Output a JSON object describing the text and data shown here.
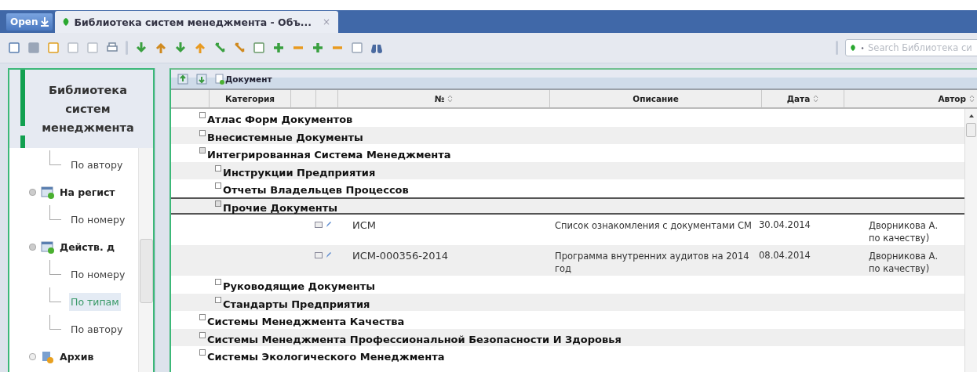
{
  "tabs": [
    {
      "kind": "open",
      "label": "Open",
      "selected": false
    },
    {
      "kind": "page",
      "label": "Библиотека систем менеджмента - Объ...",
      "close": "×",
      "selected": true
    }
  ],
  "search": {
    "placeholder": "Search Библиотека си"
  },
  "sidebar": {
    "title": "Библиотека систем менеджмента",
    "items": [
      {
        "kind": "leaf",
        "label": "По автору",
        "selected": false
      },
      {
        "kind": "node",
        "label": "На регист",
        "expanded": true,
        "selected": false,
        "children": [
          {
            "kind": "leaf",
            "label": "По номеру",
            "selected": false
          }
        ]
      },
      {
        "kind": "node",
        "label": "Действ. д",
        "expanded": true,
        "selected": false,
        "children": [
          {
            "kind": "leaf",
            "label": "По номеру",
            "selected": false
          },
          {
            "kind": "leaf",
            "label": "По типам",
            "selected": true
          },
          {
            "kind": "leaf",
            "label": "По автору",
            "selected": false
          }
        ]
      },
      {
        "kind": "archive",
        "label": "Архив",
        "expanded": false,
        "selected": false
      }
    ]
  },
  "grid": {
    "toolbar": {
      "new_button": "Документ"
    },
    "columns": [
      {
        "label": "Категория",
        "sortable": false
      },
      {
        "label": "№",
        "sortable": true
      },
      {
        "label": "Описание",
        "sortable": false
      },
      {
        "label": "Дата",
        "sortable": true
      },
      {
        "label": "Автор",
        "sortable": true
      }
    ],
    "rows": [
      {
        "kind": "group",
        "label": "Атлас Форм Документов",
        "expanded": false,
        "selected": false
      },
      {
        "kind": "group",
        "label": "Внесистемные Документы",
        "expanded": false,
        "selected": false
      },
      {
        "kind": "group",
        "label": "Интегрированная Система Менеджмента",
        "expanded": true,
        "selected": false,
        "children": [
          {
            "kind": "group",
            "label": "Инструкции Предприятия",
            "expanded": false,
            "selected": false
          },
          {
            "kind": "group",
            "label": "Отчеты Владельцев Процессов",
            "expanded": false,
            "selected": false
          },
          {
            "kind": "group",
            "label": "Прочие Документы",
            "expanded": true,
            "selected": true,
            "children": [
              {
                "kind": "document",
                "number": "ИСМ",
                "description": "Список ознакомления с документами СМ",
                "date": "30.04.2014",
                "author": [
                  "Дворникова А.",
                  "по качеству)"
                ]
              },
              {
                "kind": "document",
                "number": "ИСМ-000356-2014",
                "description": "Программа внутренних аудитов на 2014 год",
                "date": "08.04.2014",
                "author": [
                  "Дворникова А.",
                  "по качеству)"
                ]
              }
            ]
          },
          {
            "kind": "group",
            "label": "Руководящие Документы",
            "expanded": false,
            "selected": false
          },
          {
            "kind": "group",
            "label": "Стандарты Предприятия",
            "expanded": false,
            "selected": false
          }
        ]
      },
      {
        "kind": "group",
        "label": "Системы Менеджмента Качества",
        "expanded": false,
        "selected": false
      },
      {
        "kind": "group",
        "label": "Системы Менеджмента Профессиональной Безопасности И Здоровья",
        "expanded": false,
        "selected": false
      },
      {
        "kind": "group",
        "label": "Системы Экологического Менеджмента",
        "expanded": false,
        "selected": false
      }
    ]
  }
}
